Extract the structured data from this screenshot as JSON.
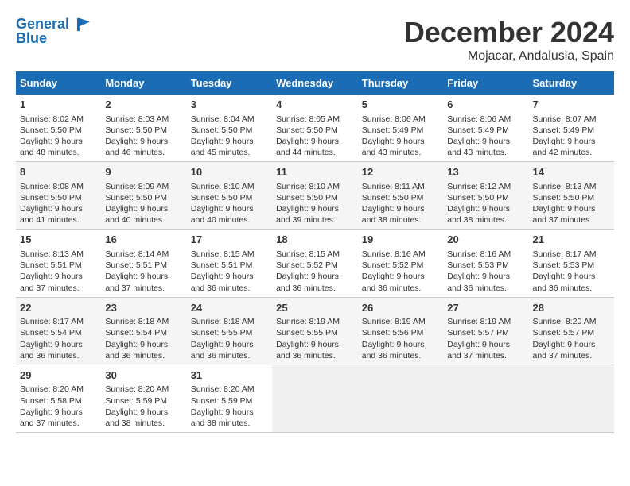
{
  "logo": {
    "line1": "General",
    "line2": "Blue"
  },
  "title": "December 2024",
  "location": "Mojacar, Andalusia, Spain",
  "days_of_week": [
    "Sunday",
    "Monday",
    "Tuesday",
    "Wednesday",
    "Thursday",
    "Friday",
    "Saturday"
  ],
  "weeks": [
    [
      {
        "day": 1,
        "sunrise": "8:02 AM",
        "sunset": "5:50 PM",
        "daylight": "9 hours and 48 minutes."
      },
      {
        "day": 2,
        "sunrise": "8:03 AM",
        "sunset": "5:50 PM",
        "daylight": "9 hours and 46 minutes."
      },
      {
        "day": 3,
        "sunrise": "8:04 AM",
        "sunset": "5:50 PM",
        "daylight": "9 hours and 45 minutes."
      },
      {
        "day": 4,
        "sunrise": "8:05 AM",
        "sunset": "5:50 PM",
        "daylight": "9 hours and 44 minutes."
      },
      {
        "day": 5,
        "sunrise": "8:06 AM",
        "sunset": "5:49 PM",
        "daylight": "9 hours and 43 minutes."
      },
      {
        "day": 6,
        "sunrise": "8:06 AM",
        "sunset": "5:49 PM",
        "daylight": "9 hours and 43 minutes."
      },
      {
        "day": 7,
        "sunrise": "8:07 AM",
        "sunset": "5:49 PM",
        "daylight": "9 hours and 42 minutes."
      }
    ],
    [
      {
        "day": 8,
        "sunrise": "8:08 AM",
        "sunset": "5:50 PM",
        "daylight": "9 hours and 41 minutes."
      },
      {
        "day": 9,
        "sunrise": "8:09 AM",
        "sunset": "5:50 PM",
        "daylight": "9 hours and 40 minutes."
      },
      {
        "day": 10,
        "sunrise": "8:10 AM",
        "sunset": "5:50 PM",
        "daylight": "9 hours and 40 minutes."
      },
      {
        "day": 11,
        "sunrise": "8:10 AM",
        "sunset": "5:50 PM",
        "daylight": "9 hours and 39 minutes."
      },
      {
        "day": 12,
        "sunrise": "8:11 AM",
        "sunset": "5:50 PM",
        "daylight": "9 hours and 38 minutes."
      },
      {
        "day": 13,
        "sunrise": "8:12 AM",
        "sunset": "5:50 PM",
        "daylight": "9 hours and 38 minutes."
      },
      {
        "day": 14,
        "sunrise": "8:13 AM",
        "sunset": "5:50 PM",
        "daylight": "9 hours and 37 minutes."
      }
    ],
    [
      {
        "day": 15,
        "sunrise": "8:13 AM",
        "sunset": "5:51 PM",
        "daylight": "9 hours and 37 minutes."
      },
      {
        "day": 16,
        "sunrise": "8:14 AM",
        "sunset": "5:51 PM",
        "daylight": "9 hours and 37 minutes."
      },
      {
        "day": 17,
        "sunrise": "8:15 AM",
        "sunset": "5:51 PM",
        "daylight": "9 hours and 36 minutes."
      },
      {
        "day": 18,
        "sunrise": "8:15 AM",
        "sunset": "5:52 PM",
        "daylight": "9 hours and 36 minutes."
      },
      {
        "day": 19,
        "sunrise": "8:16 AM",
        "sunset": "5:52 PM",
        "daylight": "9 hours and 36 minutes."
      },
      {
        "day": 20,
        "sunrise": "8:16 AM",
        "sunset": "5:53 PM",
        "daylight": "9 hours and 36 minutes."
      },
      {
        "day": 21,
        "sunrise": "8:17 AM",
        "sunset": "5:53 PM",
        "daylight": "9 hours and 36 minutes."
      }
    ],
    [
      {
        "day": 22,
        "sunrise": "8:17 AM",
        "sunset": "5:54 PM",
        "daylight": "9 hours and 36 minutes."
      },
      {
        "day": 23,
        "sunrise": "8:18 AM",
        "sunset": "5:54 PM",
        "daylight": "9 hours and 36 minutes."
      },
      {
        "day": 24,
        "sunrise": "8:18 AM",
        "sunset": "5:55 PM",
        "daylight": "9 hours and 36 minutes."
      },
      {
        "day": 25,
        "sunrise": "8:19 AM",
        "sunset": "5:55 PM",
        "daylight": "9 hours and 36 minutes."
      },
      {
        "day": 26,
        "sunrise": "8:19 AM",
        "sunset": "5:56 PM",
        "daylight": "9 hours and 36 minutes."
      },
      {
        "day": 27,
        "sunrise": "8:19 AM",
        "sunset": "5:57 PM",
        "daylight": "9 hours and 37 minutes."
      },
      {
        "day": 28,
        "sunrise": "8:20 AM",
        "sunset": "5:57 PM",
        "daylight": "9 hours and 37 minutes."
      }
    ],
    [
      {
        "day": 29,
        "sunrise": "8:20 AM",
        "sunset": "5:58 PM",
        "daylight": "9 hours and 37 minutes."
      },
      {
        "day": 30,
        "sunrise": "8:20 AM",
        "sunset": "5:59 PM",
        "daylight": "9 hours and 38 minutes."
      },
      {
        "day": 31,
        "sunrise": "8:20 AM",
        "sunset": "5:59 PM",
        "daylight": "9 hours and 38 minutes."
      },
      null,
      null,
      null,
      null
    ]
  ]
}
